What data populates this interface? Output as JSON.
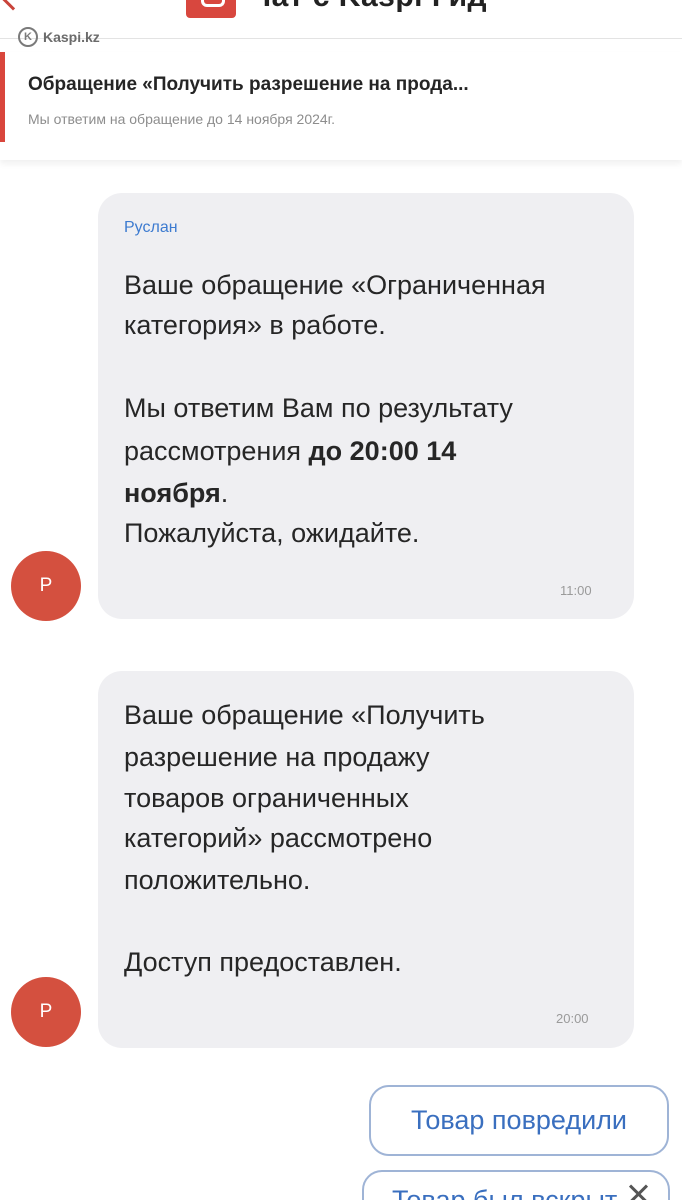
{
  "header": {
    "title": "Чат с Kaspi Гид",
    "watermark_logo": "K",
    "watermark": "Kaspi.kz"
  },
  "appeal": {
    "title": "Обращение «Получить разрешение на прода...",
    "subtitle": "Мы ответим на обращение до 14 ноября 2024г."
  },
  "messages": [
    {
      "sender": "Руслан",
      "avatar": "Р",
      "lines": {
        "l1": "Ваше обращение «Ограниченная",
        "l2": "категория» в работе.",
        "l3": "Мы ответим Вам по результату",
        "l4_pre": "рассмотрения ",
        "l4_bold": "до 20:00 14",
        "l5_bold": "ноября",
        "l5_post": ".",
        "l6": "Пожалуйста, ожидайте."
      },
      "time": "11:00"
    },
    {
      "avatar": "Р",
      "lines": {
        "l1": "Ваше обращение «Получить",
        "l2": "разрешение на продажу",
        "l3": "товаров ограниченных",
        "l4": "категорий» рассмотрено",
        "l5": "положительно.",
        "l6": "Доступ предоставлен."
      },
      "time": "20:00"
    }
  ],
  "quick_replies": [
    {
      "label": "Товар повредили"
    },
    {
      "label": "Товар был вскрыт"
    }
  ],
  "colors": {
    "accent": "#d9463c",
    "bubble": "#efeff2",
    "link": "#3d7bd0"
  }
}
